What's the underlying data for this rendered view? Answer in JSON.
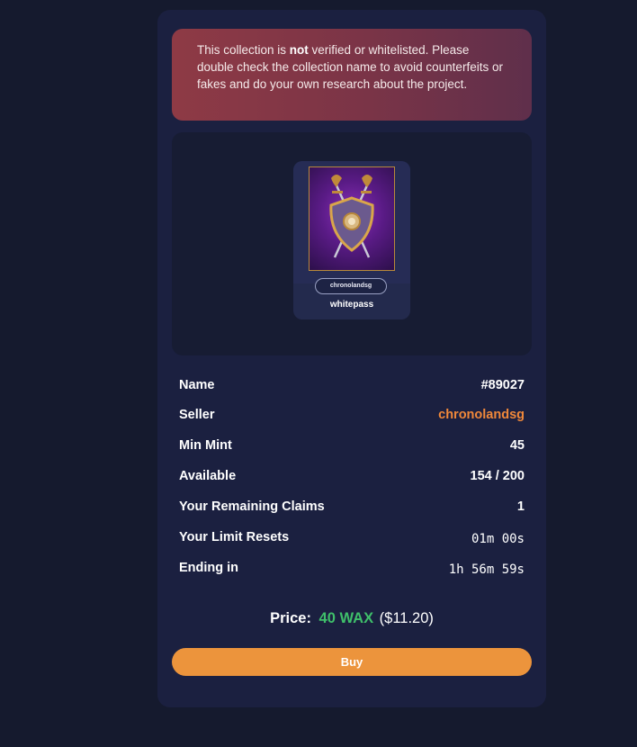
{
  "warning": {
    "prefix": "This collection is ",
    "emphasis": "not",
    "suffix": " verified or whitelisted. Please double check the collection name to avoid counterfeits or fakes and do your own research about the project."
  },
  "card": {
    "collection": "chronolandsg",
    "name": "whitepass",
    "image_icon": "shield-crossed-swords-icon"
  },
  "details": [
    {
      "label": "Name",
      "value": "#89027"
    },
    {
      "label": "Seller",
      "value": "chronolandsg"
    },
    {
      "label": "Min Mint",
      "value": "45"
    },
    {
      "label": "Available",
      "value": "154 / 200"
    },
    {
      "label": "Your Remaining Claims",
      "value": "1"
    },
    {
      "label": "Your Limit Resets",
      "value": "01m 00s"
    },
    {
      "label": "Ending in",
      "value": "1h 56m 59s"
    }
  ],
  "price": {
    "label": "Price:",
    "wax": "40 WAX",
    "usd": "($11.20)"
  },
  "buy_label": "Buy",
  "colors": {
    "background": "#151a2e",
    "panel": "#1b2040",
    "seller_link": "#f0883a",
    "price_wax": "#3fbf6a",
    "buy_button": "#ec943c",
    "warning": "#8e3a45"
  }
}
